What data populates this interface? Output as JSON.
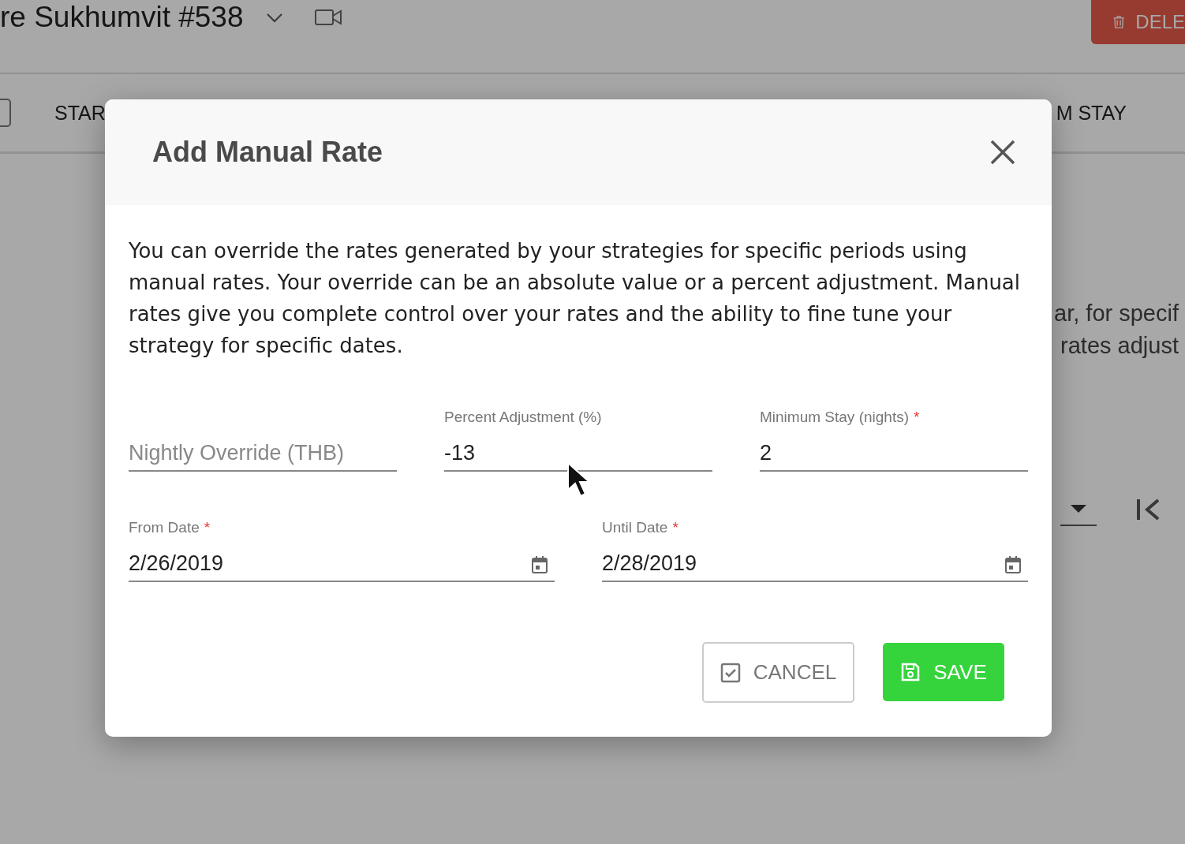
{
  "page": {
    "title": "re Sukhumvit #538",
    "delete_button": "DELE",
    "table": {
      "header_checkbox": {
        "checked": false
      },
      "columns": [
        "STAR",
        "M STAY"
      ]
    },
    "info_lines": [
      "ar, for specif",
      "rates adjust"
    ]
  },
  "dialog": {
    "title": "Add Manual Rate",
    "description": "You can override the rates generated by your strategies for specific periods using manual rates. Your override can be an absolute value or a percent adjustment. Manual rates give you complete control over your rates and the ability to fine tune your strategy for specific dates.",
    "field_rows": [
      [
        {
          "kind": "number",
          "placeholder": "Nightly Override (THB)"
        },
        {
          "kind": "number",
          "label": "Percent Adjustment (%)",
          "value": "-13"
        },
        {
          "kind": "number",
          "label": "Minimum Stay (nights)",
          "required_mark": "*",
          "value": "2"
        }
      ],
      [
        {
          "kind": "date",
          "label": "From Date",
          "required_mark": "*",
          "value": "2/26/2019"
        },
        {
          "kind": "date",
          "label": "Until Date",
          "required_mark": "*",
          "value": "2/28/2019"
        }
      ]
    ],
    "buttons": [
      {
        "kind": "cancel",
        "label": "CANCEL"
      },
      {
        "kind": "save",
        "label": "SAVE"
      }
    ]
  }
}
